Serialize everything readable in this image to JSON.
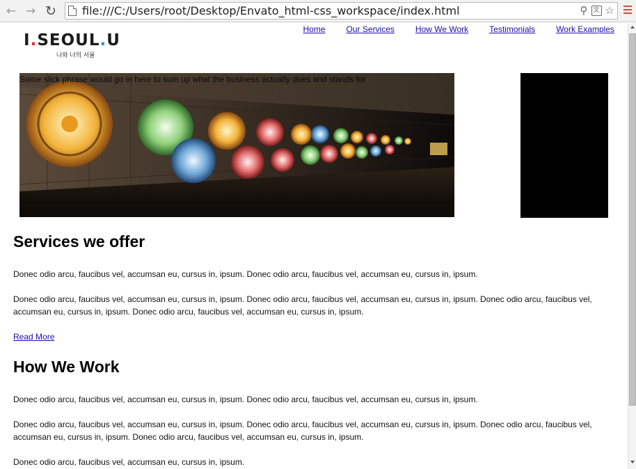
{
  "browser": {
    "url": "file:///C:/Users/root/Desktop/Envato_html-css_workspace/index.html",
    "icons": [
      "back-arrow-icon",
      "forward-arrow-icon",
      "reload-icon",
      "page-icon",
      "search-icon",
      "translate-icon",
      "star-icon",
      "menu-icon"
    ]
  },
  "logo": {
    "text_main_1": "I",
    "text_main_2": "SE",
    "text_main_3": "O",
    "text_main_4": "UL",
    "text_main_5": "U",
    "subtext": "나와 너의 서울"
  },
  "nav": {
    "items": [
      {
        "label": "Home"
      },
      {
        "label": "Our Services"
      },
      {
        "label": "How We Work"
      },
      {
        "label": "Testimonials"
      },
      {
        "label": "Work Examples"
      }
    ]
  },
  "hero": {
    "slogan": "Some slick phrase would go in here to sum up what the business actually does and stands for"
  },
  "services": {
    "heading": "Services we offer",
    "para1": "Donec odio arcu, faucibus vel, accumsan eu, cursus in, ipsum. Donec odio arcu, faucibus vel, accumsan eu, cursus in, ipsum.",
    "para2": "Donec odio arcu, faucibus vel, accumsan eu, cursus in, ipsum. Donec odio arcu, faucibus vel, accumsan eu, cursus in, ipsum. Donec odio arcu, faucibus vel, accumsan eu, cursus in, ipsum. Donec odio arcu, faucibus vel, accumsan eu, cursus in, ipsum.",
    "read_more": "Read More"
  },
  "how_we_work": {
    "heading": "How We Work",
    "para1": "Donec odio arcu, faucibus vel, accumsan eu, cursus in, ipsum. Donec odio arcu, faucibus vel, accumsan eu, cursus in, ipsum.",
    "para2": "Donec odio arcu, faucibus vel, accumsan eu, cursus in, ipsum. Donec odio arcu, faucibus vel, accumsan eu, cursus in, ipsum. Donec odio arcu, faucibus vel, accumsan eu, cursus in, ipsum. Donec odio arcu, faucibus vel, accumsan eu, cursus in, ipsum.",
    "para3": "Donec odio arcu, faucibus vel, accumsan eu, cursus in, ipsum."
  },
  "colors": {
    "link": "#1a0dab",
    "side_box": "#000000",
    "logo_red": "#e0332b",
    "logo_blue": "#2b8fd6"
  }
}
